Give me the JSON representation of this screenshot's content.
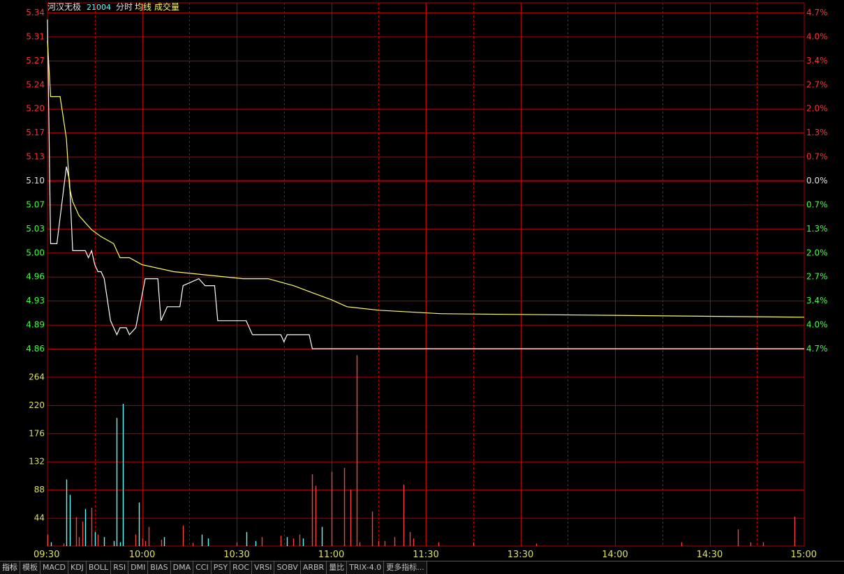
{
  "header": {
    "stock_name": "河汉无极",
    "stock_code": "21004",
    "view_label": "分时",
    "avg_label": "均线",
    "volume_label": "成交量"
  },
  "colors": {
    "background": "#000000",
    "grid": "#b00000",
    "price_line": "#ffffff",
    "avg_line": "#ffff66",
    "up": "#ff3030",
    "down": "#40ff40",
    "neutral": "#e0e0e0",
    "volume_up": "#ff4040",
    "volume_down": "#60ffff"
  },
  "chart_data": {
    "type": "line",
    "prev_close": 5.1,
    "price_axis": {
      "ticks": [
        "5.34",
        "5.31",
        "5.27",
        "5.24",
        "5.20",
        "5.17",
        "5.13",
        "5.10",
        "5.07",
        "5.03",
        "5.00",
        "4.96",
        "4.93",
        "4.89",
        "4.86"
      ],
      "range": [
        4.86,
        5.34
      ]
    },
    "percent_axis": {
      "ticks": [
        "4.7%",
        "4.0%",
        "3.4%",
        "2.7%",
        "2.0%",
        "1.3%",
        "0.7%",
        "0.0%",
        "0.7%",
        "1.3%",
        "2.0%",
        "2.7%",
        "3.4%",
        "4.0%",
        "4.7%"
      ]
    },
    "volume_axis": {
      "ticks": [
        "264",
        "220",
        "176",
        "132",
        "88",
        "44"
      ],
      "range": [
        0,
        308
      ]
    },
    "time_labels": [
      "09:30",
      "10:00",
      "10:30",
      "11:00",
      "11:30",
      "13:30",
      "14:00",
      "14:30",
      "15:00"
    ],
    "minutes_total": 240,
    "series": [
      {
        "key": "price",
        "points": [
          [
            0,
            5.33
          ],
          [
            1,
            5.01
          ],
          [
            3,
            5.01
          ],
          [
            6,
            5.12
          ],
          [
            7,
            5.1
          ],
          [
            8,
            5.0
          ],
          [
            12,
            5.0
          ],
          [
            13,
            4.99
          ],
          [
            14,
            5.0
          ],
          [
            15,
            4.98
          ],
          [
            16,
            4.97
          ],
          [
            17,
            4.97
          ],
          [
            18,
            4.96
          ],
          [
            20,
            4.9
          ],
          [
            22,
            4.88
          ],
          [
            23,
            4.89
          ],
          [
            25,
            4.89
          ],
          [
            26,
            4.88
          ],
          [
            28,
            4.89
          ],
          [
            31,
            4.96
          ],
          [
            35,
            4.96
          ],
          [
            36,
            4.9
          ],
          [
            37,
            4.91
          ],
          [
            38,
            4.92
          ],
          [
            42,
            4.92
          ],
          [
            43,
            4.95
          ],
          [
            48,
            4.96
          ],
          [
            50,
            4.95
          ],
          [
            53,
            4.95
          ],
          [
            54,
            4.9
          ],
          [
            63,
            4.9
          ],
          [
            64,
            4.89
          ],
          [
            65,
            4.88
          ],
          [
            74,
            4.88
          ],
          [
            75,
            4.87
          ],
          [
            76,
            4.88
          ],
          [
            83,
            4.88
          ],
          [
            84,
            4.86
          ],
          [
            240,
            4.86
          ]
        ]
      },
      {
        "key": "avg",
        "points": [
          [
            0,
            5.3
          ],
          [
            1,
            5.22
          ],
          [
            4,
            5.22
          ],
          [
            6,
            5.16
          ],
          [
            7,
            5.09
          ],
          [
            8,
            5.07
          ],
          [
            10,
            5.05
          ],
          [
            12,
            5.04
          ],
          [
            14,
            5.03
          ],
          [
            17,
            5.02
          ],
          [
            21,
            5.01
          ],
          [
            23,
            4.99
          ],
          [
            26,
            4.99
          ],
          [
            30,
            4.98
          ],
          [
            40,
            4.97
          ],
          [
            62,
            4.96
          ],
          [
            70,
            4.96
          ],
          [
            78,
            4.95
          ],
          [
            84,
            4.94
          ],
          [
            90,
            4.93
          ],
          [
            95,
            4.92
          ],
          [
            105,
            4.915
          ],
          [
            125,
            4.91
          ],
          [
            240,
            4.905
          ]
        ]
      }
    ],
    "volume": [
      [
        0,
        18,
        "up"
      ],
      [
        1,
        6,
        "down"
      ],
      [
        5,
        4,
        "up"
      ],
      [
        6,
        104,
        "down"
      ],
      [
        7,
        80,
        "down"
      ],
      [
        9,
        45,
        "up"
      ],
      [
        10,
        14,
        "up"
      ],
      [
        11,
        38,
        "up"
      ],
      [
        12,
        58,
        "down"
      ],
      [
        14,
        60,
        "up"
      ],
      [
        15,
        22,
        "down"
      ],
      [
        16,
        18,
        "up"
      ],
      [
        18,
        14,
        "down"
      ],
      [
        21,
        8,
        "down"
      ],
      [
        22,
        200,
        "down"
      ],
      [
        23,
        6,
        "down"
      ],
      [
        24,
        222,
        "down"
      ],
      [
        28,
        18,
        "up"
      ],
      [
        29,
        68,
        "down"
      ],
      [
        30,
        12,
        "up"
      ],
      [
        31,
        8,
        "up"
      ],
      [
        32,
        30,
        "up"
      ],
      [
        36,
        10,
        "up"
      ],
      [
        37,
        14,
        "down"
      ],
      [
        43,
        32,
        "up"
      ],
      [
        46,
        5,
        "up"
      ],
      [
        49,
        18,
        "down"
      ],
      [
        51,
        12,
        "down"
      ],
      [
        60,
        6,
        "up"
      ],
      [
        63,
        22,
        "down"
      ],
      [
        66,
        8,
        "down"
      ],
      [
        68,
        14,
        "up"
      ],
      [
        74,
        16,
        "up"
      ],
      [
        76,
        14,
        "down"
      ],
      [
        78,
        12,
        "up"
      ],
      [
        80,
        18,
        "up"
      ],
      [
        81,
        12,
        "down"
      ],
      [
        84,
        112,
        "up"
      ],
      [
        85,
        94,
        "up"
      ],
      [
        87,
        30,
        "down"
      ],
      [
        90,
        116,
        "up"
      ],
      [
        94,
        122,
        "up"
      ],
      [
        96,
        88,
        "up"
      ],
      [
        98,
        298,
        "up"
      ],
      [
        99,
        6,
        "up"
      ],
      [
        103,
        54,
        "up"
      ],
      [
        105,
        8,
        "up"
      ],
      [
        107,
        8,
        "up"
      ],
      [
        110,
        14,
        "up"
      ],
      [
        113,
        96,
        "up"
      ],
      [
        115,
        22,
        "up"
      ],
      [
        116,
        12,
        "up"
      ],
      [
        124,
        6,
        "up"
      ],
      [
        135,
        6,
        "up"
      ],
      [
        155,
        4,
        "up"
      ],
      [
        201,
        6,
        "up"
      ],
      [
        219,
        26,
        "up"
      ],
      [
        223,
        6,
        "up"
      ],
      [
        227,
        6,
        "up"
      ],
      [
        237,
        46,
        "up"
      ]
    ]
  },
  "indicator_tabs": [
    "指标",
    "模板",
    "MACD",
    "KDJ",
    "BOLL",
    "RSI",
    "DMI",
    "BIAS",
    "DMA",
    "CCI",
    "PSY",
    "ROC",
    "VRSI",
    "SOBV",
    "ARBR",
    "量比",
    "TRIX-4.0",
    "更多指标..."
  ]
}
